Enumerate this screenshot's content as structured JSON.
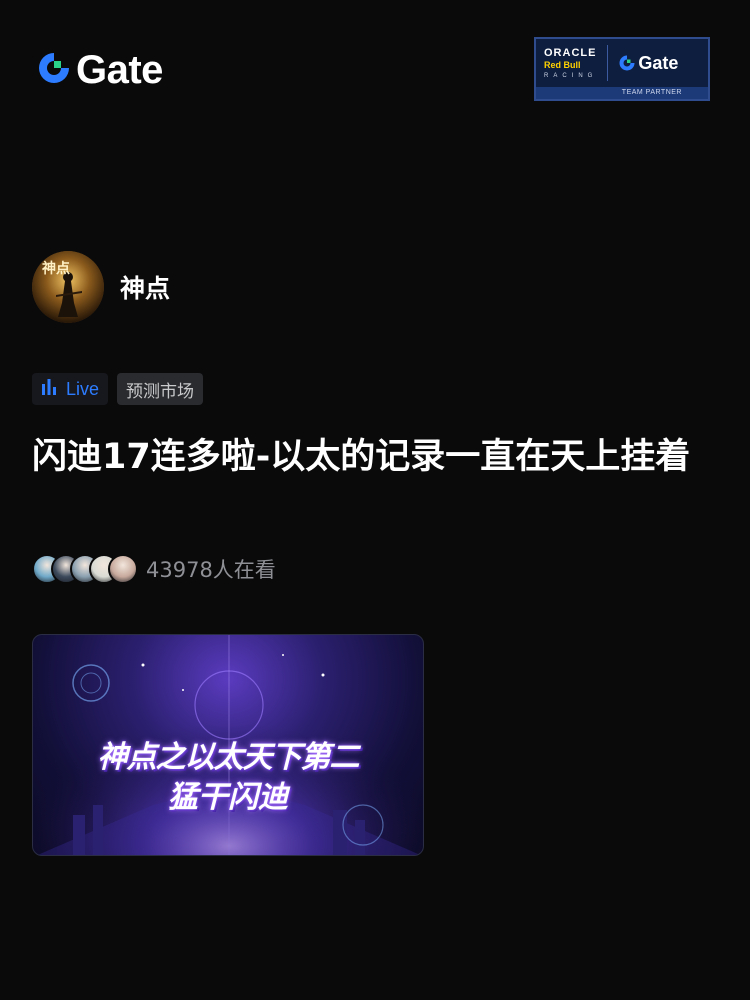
{
  "header": {
    "brand": "Gate",
    "partner_badge": {
      "team_line1": "ORACLE",
      "team_line2": "Red Bull",
      "team_line3": "RACING",
      "brand": "Gate",
      "caption": "TEAM PARTNER"
    }
  },
  "author": {
    "name": "神点",
    "avatar_icon": "warrior-avatar"
  },
  "tags": {
    "live_label": "Live",
    "category_label": "预测市场"
  },
  "post": {
    "title": "闪迪17连多啦-以太的记录一直在天上挂着"
  },
  "viewers": {
    "count_text": "43978人在看",
    "avatar_colors": [
      "#6fa9c9",
      "#3c4a5c",
      "#8aa0b0",
      "#d9dbd4",
      "#c7a99c"
    ]
  },
  "cover": {
    "line1": "神点之以太天下第二",
    "line2": "猛干闪迪"
  },
  "colors": {
    "background": "#0a0a0b",
    "accent_blue": "#2d7cff",
    "gate_green": "#2bd28a"
  }
}
